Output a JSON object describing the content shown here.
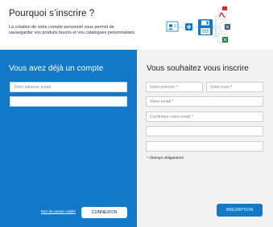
{
  "header": {
    "title": "Pourquoi s’inscrire ?",
    "intro": "La création de votre compte personnel vous permet de sauvegarder vos produits favoris et vos catalogues personnalisés."
  },
  "login": {
    "heading": "Vous avez déjà un compte",
    "email_placeholder": "Votre adresse email",
    "password_placeholder": "",
    "forgot_label": "Mot de passe oublié",
    "submit_label": "CONNEXION"
  },
  "register": {
    "heading": "Vous souhaitez vous inscrire",
    "firstname_placeholder": "Votre prénom *",
    "lastname_placeholder": "Votre nom *",
    "email_placeholder": "Votre email *",
    "confirm_email_placeholder": "Confirmez votre email *",
    "password_placeholder": "",
    "confirm_password_placeholder": "",
    "required_note": "* champs obligatoires",
    "submit_label": "INSCRIPTION"
  },
  "colors": {
    "accent_blue": "#1278c8",
    "panel_grey": "#f2f2f2",
    "pdf_red": "#d9262b",
    "excel_green": "#1d7a3f",
    "word_blue": "#2b579a"
  },
  "icons": {
    "illustration": [
      "contact-card-icon",
      "gear-icon",
      "floppy-disk-icon",
      "pdf-file-icon",
      "word-file-icon",
      "excel-file-icon"
    ]
  }
}
